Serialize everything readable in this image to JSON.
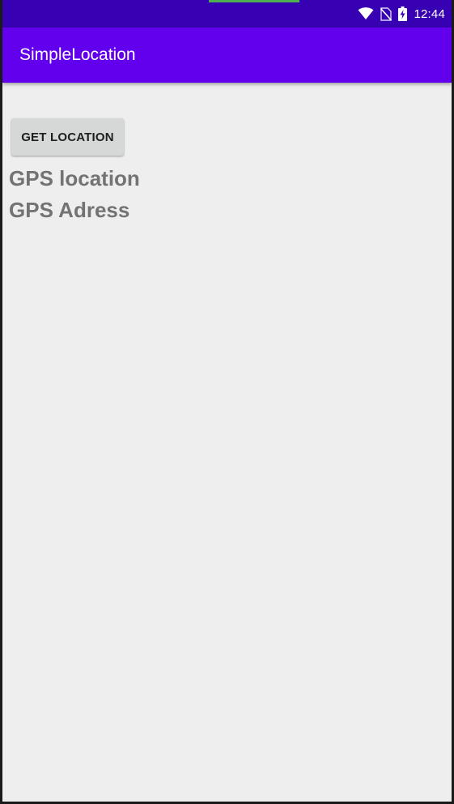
{
  "status_bar": {
    "time": "12:44",
    "icons": [
      "wifi-icon",
      "no-sim-icon",
      "battery-charging-icon"
    ],
    "background": "#3700b3"
  },
  "app_bar": {
    "title": "SimpleLocation",
    "background": "#6200ee"
  },
  "main": {
    "get_location_button": "GET LOCATION",
    "gps_location_text": "GPS location",
    "gps_address_text": "GPS Adress"
  }
}
